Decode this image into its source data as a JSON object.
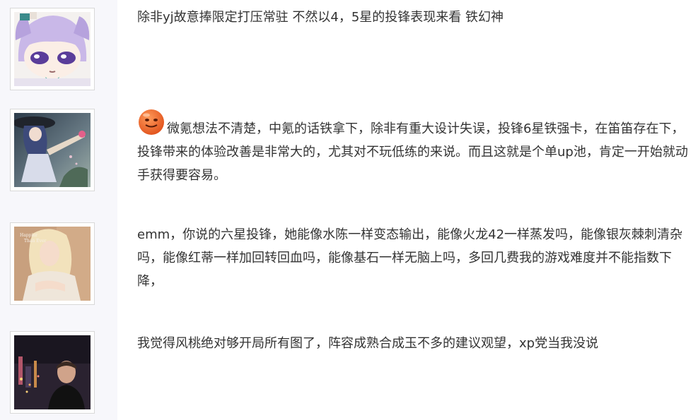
{
  "posts": [
    {
      "avatar": "user-avatar",
      "text": "除非yj故意捧限定打压常驻 不然以4，5星的投锋表现来看 铁幻神"
    },
    {
      "avatar": "user-avatar",
      "emoji": "orange-face-emoji",
      "text": "微氪想法不清楚，中氪的话铁拿下，除非有重大设计失误，投锋6星铁强卡，在笛笛存在下，投锋带来的体验改善是非常大的，尤其对不玩低练的来说。而且这就是个单up池，肯定一开始就动手获得要容易。"
    },
    {
      "avatar": "user-avatar",
      "text": "emm，你说的六星投锋，她能像水陈一样变态输出，能像火龙42一样蒸发吗，能像银灰棘刺清杂吗，能像红蒂一样加回转回血吗，能像基石一样无脑上吗，多回几费我的游戏难度并不能指数下降，"
    },
    {
      "avatar": "user-avatar",
      "text": "我觉得风桃绝对够开局所有图了，阵容成熟合成玉不多的建议观望，xp党当我没说"
    }
  ],
  "colors": {
    "text": "#333333",
    "sidebar_bg": "#f7f7fb",
    "avatar_border": "#d8d8d8"
  }
}
